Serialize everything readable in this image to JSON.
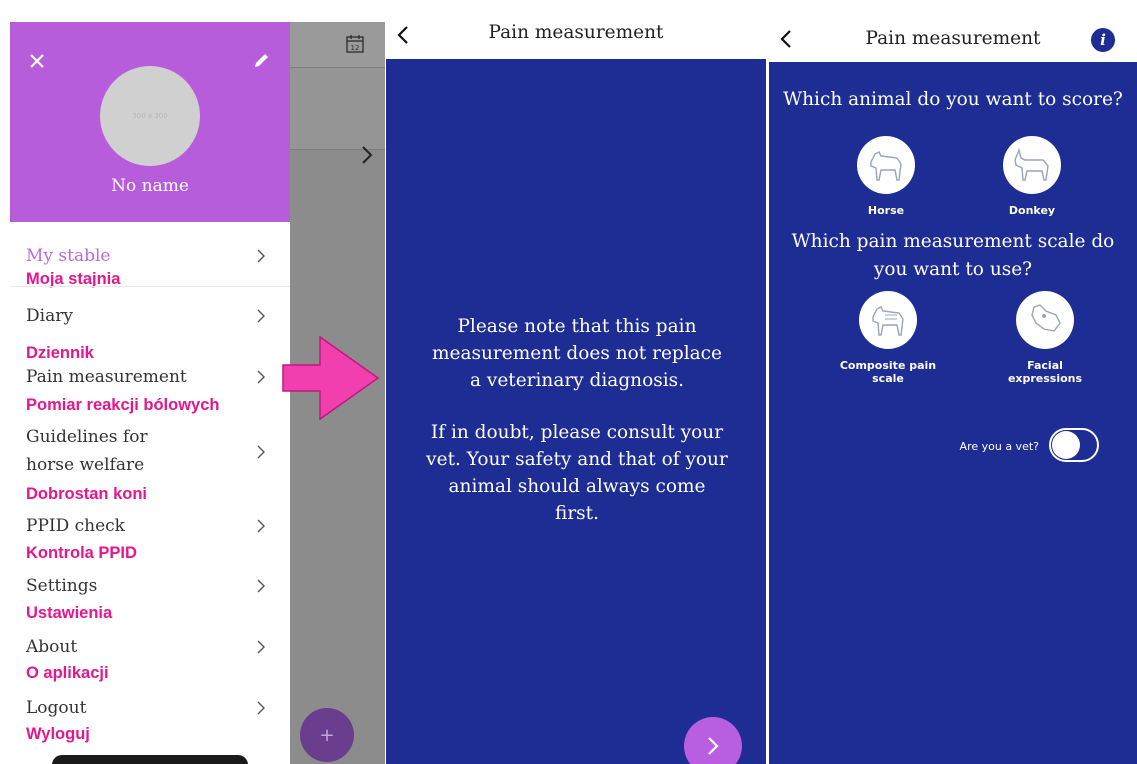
{
  "menu": {
    "profile_name": "No name",
    "avatar_placeholder": "300 x 300",
    "items": [
      {
        "label": "My stable",
        "note": "Moja stajnia"
      },
      {
        "label": "Diary",
        "note": "Dziennik"
      },
      {
        "label": "Pain measurement",
        "note": "Pomiar reakcji bólowych"
      },
      {
        "label_line1": "Guidelines for",
        "label_line2": "horse welfare",
        "note": "Dobrostan koni"
      },
      {
        "label": "PPID check",
        "note": "Kontrola PPID"
      },
      {
        "label": "Settings",
        "note": "Ustawienia"
      },
      {
        "label": "About",
        "note": "O aplikacji"
      },
      {
        "label": "Logout",
        "note": "Wyloguj"
      }
    ],
    "fab_label": "+",
    "calendar_day": "12"
  },
  "disclaimer": {
    "title": "Pain measurement",
    "paragraph1_lines": [
      "Please note that this pain",
      "measurement does not replace",
      "a veterinary diagnosis."
    ],
    "paragraph2_lines": [
      "If in doubt, please consult your",
      "vet. Your safety and that of your",
      "animal should always come",
      "first."
    ]
  },
  "chooser": {
    "title": "Pain measurement",
    "info_label": "i",
    "animal_question": "Which animal do you want to score?",
    "animals": [
      "Horse",
      "Donkey"
    ],
    "scale_question_lines": [
      "Which pain measurement scale do",
      "you want to use?"
    ],
    "scales": [
      {
        "line1": "Composite pain",
        "line2": "scale"
      },
      {
        "line1": "Facial",
        "line2": "expressions"
      }
    ],
    "vet_toggle_label": "Are you a vet?",
    "vet_toggle_on": false
  },
  "colors": {
    "profile_purple": "#b75ddb",
    "screen_blue": "#1d2d93",
    "annotation_pink": "#e5168e",
    "arrow_pink": "#f23fb0"
  },
  "icons": [
    "close-icon",
    "edit-icon",
    "calendar-icon",
    "chevron-right-icon",
    "back-chevron-icon",
    "info-icon",
    "horse-icon",
    "donkey-icon",
    "composite-pain-scale-icon",
    "facial-expressions-icon"
  ]
}
